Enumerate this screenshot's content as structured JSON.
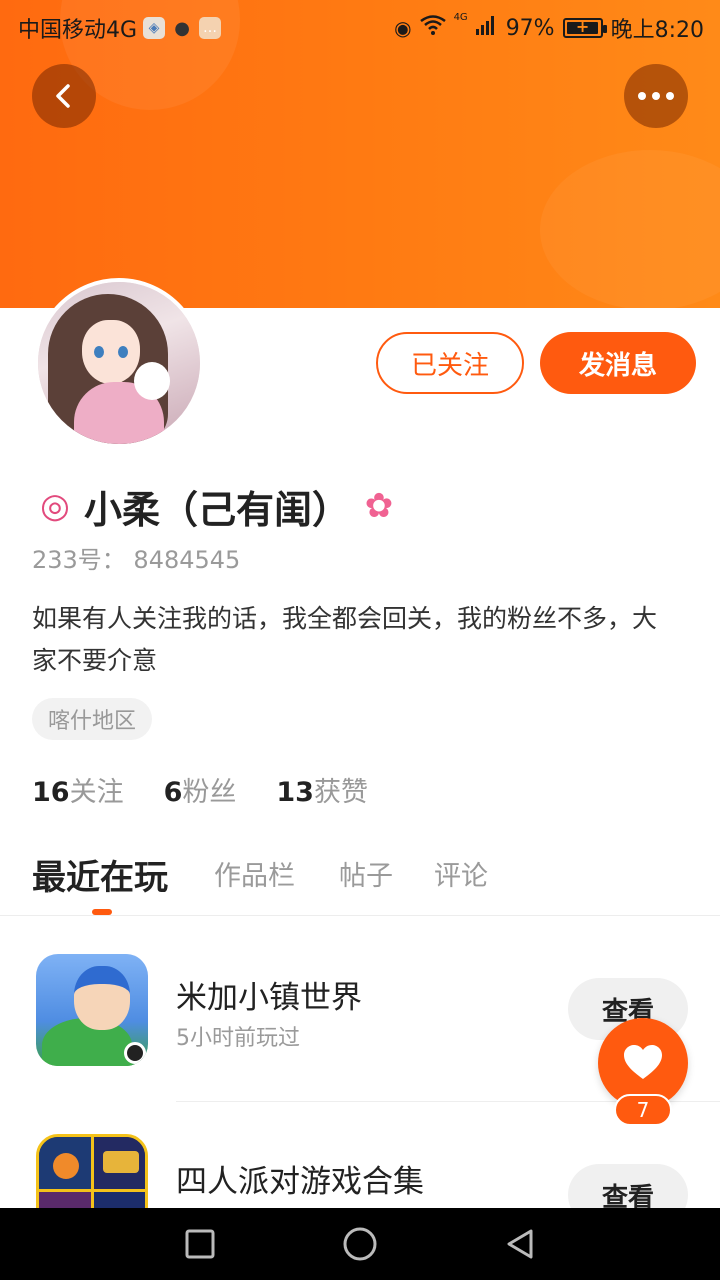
{
  "status_bar": {
    "carrier": "中国移动4G",
    "network_small": "4G",
    "battery": "97%",
    "battery_level": 0.97,
    "time": "晚上8:20",
    "icons": [
      "app-icon",
      "wechat-icon",
      "message-icon",
      "eye-icon",
      "wifi-icon",
      "signal-icon",
      "battery-icon"
    ]
  },
  "header": {
    "back_icon": "chevron-left-icon",
    "more_icon": "more-dots-icon",
    "colors": {
      "accent": "#ff5a0f",
      "header_gradient_start": "#ff6a10",
      "header_gradient_end": "#ff8a18"
    }
  },
  "profile": {
    "follow_label": "已关注",
    "message_label": "发消息",
    "name": "小柔（己有闺）",
    "name_prefix_icon": "lollipop-icon",
    "name_suffix_icon": "flower-icon",
    "uid": "233号：  8484545",
    "bio": "如果有人关注我的话，我全都会回关，我的粉丝不多，大家不要介意",
    "region": "喀什地区",
    "stats": [
      {
        "num": "16",
        "label": "关注"
      },
      {
        "num": "6",
        "label": "粉丝"
      },
      {
        "num": "13",
        "label": "获赞"
      }
    ]
  },
  "tabs": [
    {
      "label": "最近在玩",
      "active": true
    },
    {
      "label": "作品栏",
      "active": false
    },
    {
      "label": "帖子",
      "active": false
    },
    {
      "label": "评论",
      "active": false
    }
  ],
  "games": [
    {
      "title": "米加小镇世界",
      "subtitle": "5小时前玩过",
      "action": "查看"
    },
    {
      "title": "四人派对游戏合集",
      "subtitle": "",
      "action": "查看"
    }
  ],
  "like": {
    "icon": "heart-icon",
    "count": "7"
  },
  "navbar": {
    "icons": [
      "recent-apps-icon",
      "home-icon",
      "back-icon"
    ]
  }
}
